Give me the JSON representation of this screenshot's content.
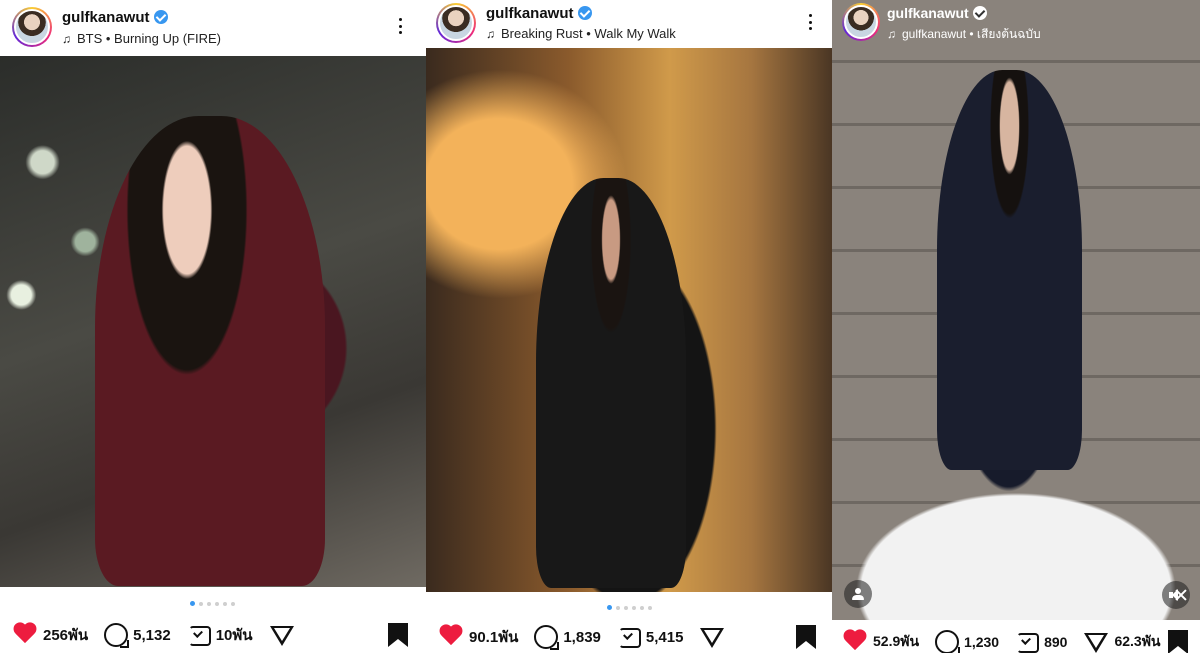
{
  "posts": [
    {
      "username": "gulfkanawut",
      "music": "BTS • Burning Up (FIRE)",
      "likes": "256พัน",
      "comments": "5,132",
      "reposts": "10พัน",
      "shares": "",
      "carousel_pages": 6,
      "carousel_active": 1,
      "sound": "on"
    },
    {
      "username": "gulfkanawut",
      "music": "Breaking Rust • Walk My Walk",
      "likes": "90.1พัน",
      "comments": "1,839",
      "reposts": "5,415",
      "shares": "",
      "carousel_pages": 6,
      "carousel_active": 1,
      "sound": "on"
    },
    {
      "username": "gulfkanawut",
      "music": "gulfkanawut • เสียงต้นฉบับ",
      "likes": "52.9พัน",
      "comments": "1,230",
      "reposts": "890",
      "shares": "62.3พัน",
      "sound": "muted"
    }
  ],
  "colors": {
    "like_heart": "#ed1c3f",
    "verified_badge": "#3897f0",
    "carousel_active_dot": "#3897f0"
  },
  "icons": [
    "avatar",
    "verified-badge-icon",
    "music-note-icon",
    "more-options-icon",
    "user-tag-icon",
    "speaker-icon",
    "speaker-muted-icon",
    "heart-icon",
    "comment-icon",
    "repost-icon",
    "share-icon",
    "bookmark-icon"
  ]
}
